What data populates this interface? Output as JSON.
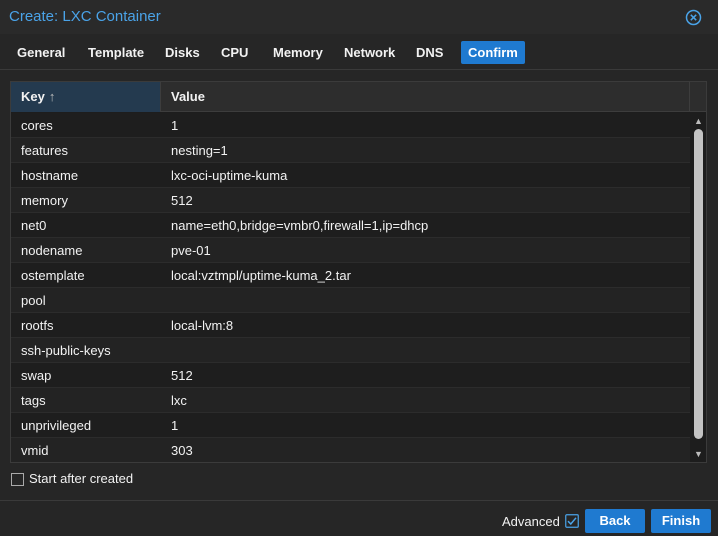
{
  "window": {
    "title": "Create: LXC Container",
    "close_icon": "close-circle-icon"
  },
  "tabs": [
    {
      "label": "General"
    },
    {
      "label": "Template"
    },
    {
      "label": "Disks"
    },
    {
      "label": "CPU"
    },
    {
      "label": "Memory"
    },
    {
      "label": "Network"
    },
    {
      "label": "DNS"
    },
    {
      "label": "Confirm",
      "active": true
    }
  ],
  "grid": {
    "columns": [
      {
        "label": "Key",
        "sort": "ascending",
        "sort_icon": "sort-ascending-arrow-icon"
      },
      {
        "label": "Value"
      }
    ],
    "rows": [
      {
        "key": "cores",
        "value": "1"
      },
      {
        "key": "features",
        "value": "nesting=1"
      },
      {
        "key": "hostname",
        "value": "lxc-oci-uptime-kuma"
      },
      {
        "key": "memory",
        "value": "512"
      },
      {
        "key": "net0",
        "value": "name=eth0,bridge=vmbr0,firewall=1,ip=dhcp"
      },
      {
        "key": "nodename",
        "value": "pve-01"
      },
      {
        "key": "ostemplate",
        "value": "local:vztmpl/uptime-kuma_2.tar"
      },
      {
        "key": "pool",
        "value": ""
      },
      {
        "key": "rootfs",
        "value": "local-lvm:8"
      },
      {
        "key": "ssh-public-keys",
        "value": ""
      },
      {
        "key": "swap",
        "value": "512"
      },
      {
        "key": "tags",
        "value": "lxc"
      },
      {
        "key": "unprivileged",
        "value": "1"
      },
      {
        "key": "vmid",
        "value": "303"
      }
    ]
  },
  "start_after_created": {
    "label": "Start after created",
    "checked": false
  },
  "footer": {
    "advanced_label": "Advanced",
    "advanced_checked": true,
    "back_label": "Back",
    "finish_label": "Finish"
  },
  "colors": {
    "accent": "#1f7ad0",
    "title": "#4aa3e8",
    "background": "#262626"
  }
}
